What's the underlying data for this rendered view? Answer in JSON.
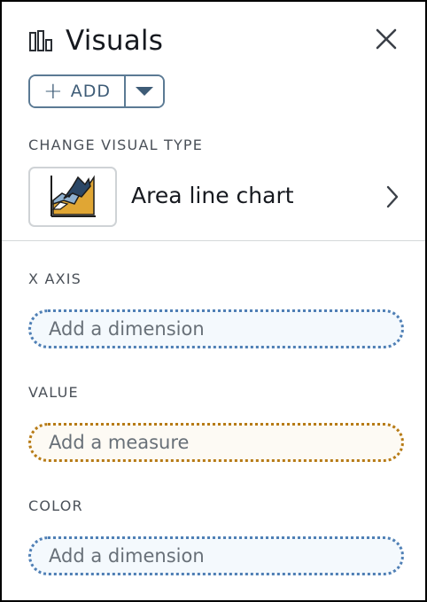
{
  "panel": {
    "title": "Visuals",
    "icons": {
      "title": "bar-chart-icon",
      "close": "close-icon"
    }
  },
  "add": {
    "label": "ADD",
    "icon": "plus-icon",
    "dropdown_icon": "caret-down-icon"
  },
  "change_visual": {
    "label": "CHANGE VISUAL TYPE",
    "current": "Area line chart",
    "thumbnail_icon": "area-line-chart-icon",
    "chevron": "chevron-right-icon"
  },
  "fields": [
    {
      "label": "X AXIS",
      "placeholder": "Add a dimension",
      "kind": "dimension"
    },
    {
      "label": "VALUE",
      "placeholder": "Add a measure",
      "kind": "measure"
    },
    {
      "label": "COLOR",
      "placeholder": "Add a dimension",
      "kind": "dimension"
    }
  ],
  "colors": {
    "accent": "#3e5c77",
    "dimension": "#4f7fb5",
    "measure": "#b77b16",
    "thumb_dark": "#2b4766",
    "thumb_light": "#8fb1d0",
    "thumb_fill": "#e0a634"
  }
}
